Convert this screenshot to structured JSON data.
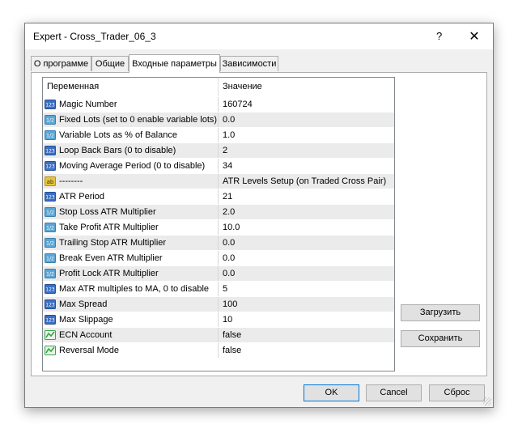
{
  "window": {
    "title": "Expert - Cross_Trader_06_3",
    "help_label": "?",
    "close_label": "✕"
  },
  "tabs": [
    {
      "label": "О программе",
      "active": false
    },
    {
      "label": "Общие",
      "active": false
    },
    {
      "label": "Входные параметры",
      "active": true
    },
    {
      "label": "Зависимости",
      "active": false
    }
  ],
  "grid": {
    "columns": [
      "Переменная",
      "Значение"
    ],
    "rows": [
      {
        "icon": "int-icon",
        "name": "Magic Number",
        "value": "160724"
      },
      {
        "icon": "double-icon",
        "name": "Fixed Lots (set to 0 enable variable lots)",
        "value": "0.0"
      },
      {
        "icon": "double-icon",
        "name": "Variable Lots as % of Balance",
        "value": "1.0"
      },
      {
        "icon": "int-icon",
        "name": "Loop Back Bars (0 to disable)",
        "value": "2"
      },
      {
        "icon": "int-icon",
        "name": "Moving Average Period (0 to disable)",
        "value": "34"
      },
      {
        "icon": "string-icon",
        "name": "--------",
        "value": "ATR Levels Setup (on Traded Cross Pair)"
      },
      {
        "icon": "int-icon",
        "name": "ATR Period",
        "value": "21"
      },
      {
        "icon": "double-icon",
        "name": "Stop Loss ATR Multiplier",
        "value": "2.0"
      },
      {
        "icon": "double-icon",
        "name": "Take Profit ATR Multiplier",
        "value": "10.0"
      },
      {
        "icon": "double-icon",
        "name": "Trailing Stop ATR Multiplier",
        "value": "0.0"
      },
      {
        "icon": "double-icon",
        "name": "Break Even ATR Multiplier",
        "value": "0.0"
      },
      {
        "icon": "double-icon",
        "name": "Profit Lock ATR Multiplier",
        "value": "0.0"
      },
      {
        "icon": "int-icon",
        "name": "Max ATR multiples to MA, 0 to disable",
        "value": "5"
      },
      {
        "icon": "int-icon",
        "name": "Max Spread",
        "value": "100"
      },
      {
        "icon": "int-icon",
        "name": "Max Slippage",
        "value": "10"
      },
      {
        "icon": "bool-icon",
        "name": "ECN Account",
        "value": "false"
      },
      {
        "icon": "bool-icon",
        "name": "Reversal Mode",
        "value": "false"
      }
    ]
  },
  "side_buttons": {
    "load_label": "Загрузить",
    "save_label": "Сохранить"
  },
  "bottom_buttons": {
    "ok_label": "OK",
    "cancel_label": "Cancel",
    "reset_label": "Сброс"
  },
  "icon_labels": {
    "int": "123",
    "double": "1/2",
    "string": "ab"
  },
  "colors": {
    "accent": "#0078d7",
    "int_icon": "#3a6fc4",
    "double_icon": "#5aa6d6",
    "string_icon": "#e9c437",
    "bool_icon": "#3aa34a"
  }
}
